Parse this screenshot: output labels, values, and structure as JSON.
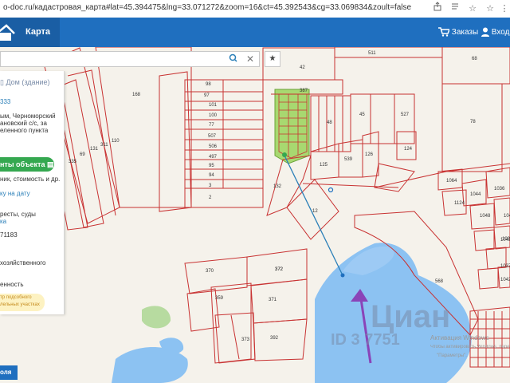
{
  "browser": {
    "url": "o-doc.ru/кадастровая_карта#lat=45.394475&lng=33.071272&zoom=16&ct=45.392543&cg=33.069834&zoult=false"
  },
  "header": {
    "tab_label": "Карта",
    "orders_label": "Заказы",
    "login_label": "Вход"
  },
  "search": {
    "value": ""
  },
  "panel": {
    "title": "Дом (здание)",
    "id_fragment": "333",
    "address_lines": [
      "ым, Черноморский",
      "ановский с/с, за",
      "еленного пункта"
    ],
    "green_button": "нты объекта",
    "sub_text": "ник, стоимость и др.",
    "date_link": "ку на дату",
    "courts_1": "ресты, суды",
    "courts_2": "ка",
    "number": "71183",
    "farm": "хозяйственного",
    "ownership": "енность",
    "similar_1": "тр подсобного",
    "similar_2": "лельных участках"
  },
  "bottom_button": "оля",
  "map": {
    "parcel_labels": [
      "511",
      "68",
      "42",
      "98",
      "387",
      "97",
      "168",
      "101",
      "100",
      "77",
      "507",
      "506",
      "497",
      "95",
      "94",
      "3",
      "2",
      "78",
      "45",
      "527",
      "48",
      "125",
      "539",
      "126",
      "124",
      "132",
      "12",
      "1064",
      "1036",
      "1044",
      "1124",
      "1048",
      "370",
      "372",
      "359",
      "371",
      "372",
      "373",
      "392",
      "568",
      "1043",
      "1046",
      "1037",
      "1039",
      "1042",
      "335",
      "69",
      "131",
      "311",
      "110"
    ],
    "watermark": "Циан",
    "watermark_id": "ID 3 7751",
    "windows_1": "Активация Windows",
    "windows_2": "Чтобы активировать Windows, перейдите в раздел",
    "windows_3": "\"Параметры\"."
  },
  "colors": {
    "nav": "#1f6fbf",
    "parcel": "#c83232",
    "water": "#8cc2f2",
    "green": "#35a850",
    "highlight": "#a8d870"
  }
}
